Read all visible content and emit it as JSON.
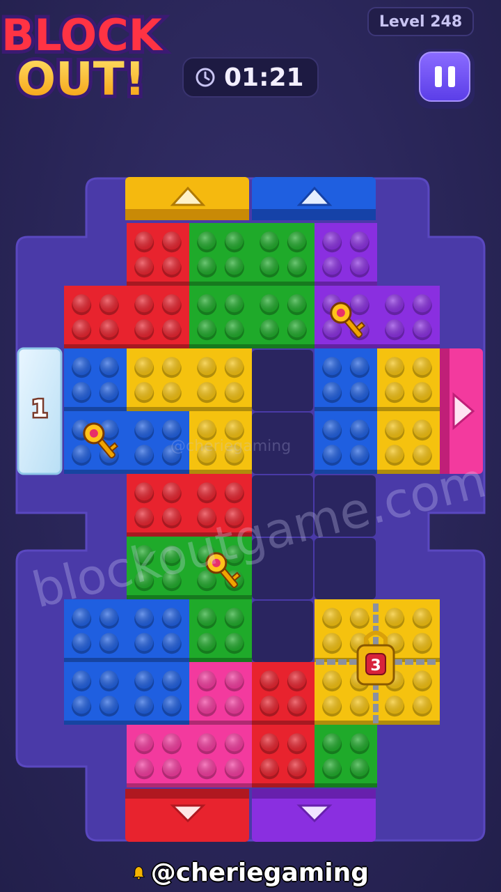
{
  "logo": {
    "line1": "BLOCK",
    "line2": "OUT!"
  },
  "level": {
    "label": "Level 248"
  },
  "timer": {
    "value": "01:21"
  },
  "pause": {
    "icon": "pause-icon"
  },
  "board": {
    "exits": [
      {
        "id": "top-yellow",
        "color": "#f5b90f",
        "direction": "up"
      },
      {
        "id": "top-blue",
        "color": "#1f5fe0",
        "direction": "up"
      },
      {
        "id": "right-pink",
        "color": "#f33a9e",
        "direction": "right"
      },
      {
        "id": "bottom-red",
        "color": "#e8232e",
        "direction": "down"
      },
      {
        "id": "bottom-purple",
        "color": "#8a2fe0",
        "direction": "down"
      }
    ],
    "ice_block": {
      "counter": "1"
    },
    "lock": {
      "counter": "3"
    },
    "key_icon": "key-icon"
  },
  "colors": {
    "red": "#e8232e",
    "green": "#1faa2a",
    "purple": "#8a2fe0",
    "blue": "#1f5fe0",
    "yellow": "#f5c20f",
    "pink": "#f33a9e",
    "frame": "#4a3aa8",
    "empty": "#2a2560"
  },
  "watermark": {
    "main": "blockoutgame.com",
    "small": "@cheriegaming"
  },
  "footer": {
    "handle": "@cheriegaming",
    "icon": "bell-icon"
  }
}
